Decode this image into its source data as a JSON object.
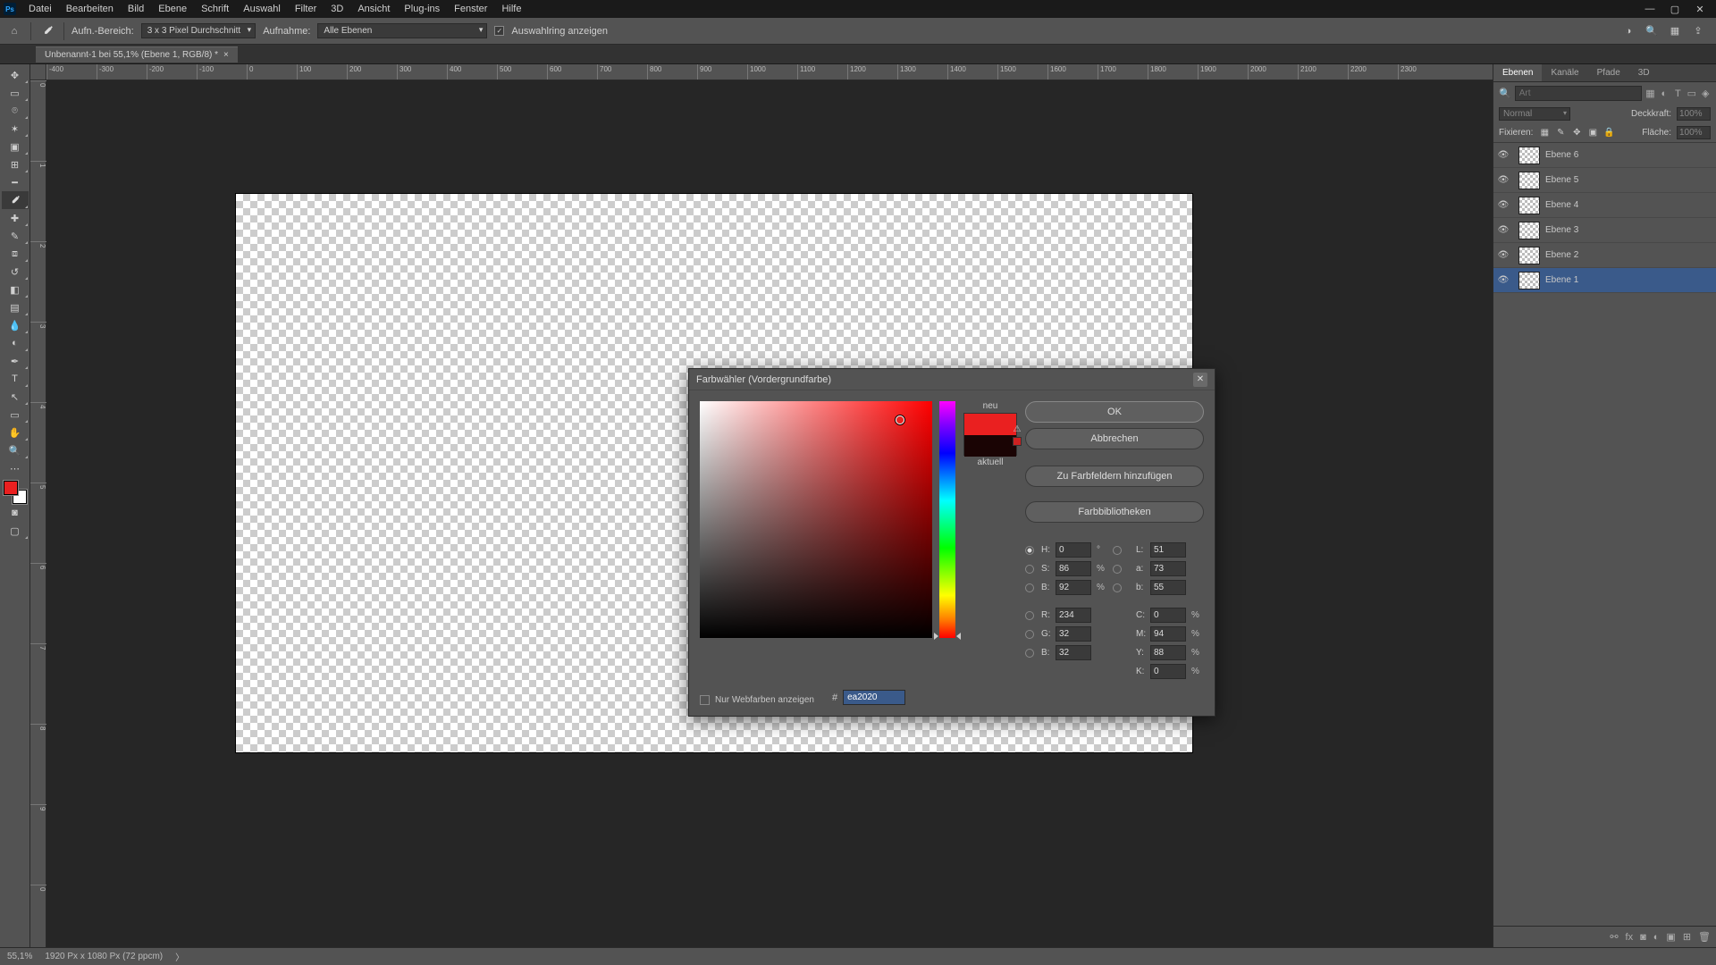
{
  "titlebar": {
    "logo": "Ps",
    "menu": [
      "Datei",
      "Bearbeiten",
      "Bild",
      "Ebene",
      "Schrift",
      "Auswahl",
      "Filter",
      "3D",
      "Ansicht",
      "Plug-ins",
      "Fenster",
      "Hilfe"
    ]
  },
  "options": {
    "label_sample": "Aufn.-Bereich:",
    "sample_value": "3 x 3 Pixel Durchschnitt",
    "label_layers": "Aufnahme:",
    "layers_value": "Alle Ebenen",
    "show_ring": "Auswahlring anzeigen"
  },
  "doc_tab": {
    "title": "Unbenannt-1 bei 55,1% (Ebene 1, RGB/8) *"
  },
  "ruler_h": [
    "-400",
    "-300",
    "-200",
    "-100",
    "0",
    "100",
    "200",
    "300",
    "400",
    "500",
    "600",
    "700",
    "800",
    "900",
    "1000",
    "1100",
    "1200",
    "1300",
    "1400",
    "1500",
    "1600",
    "1700",
    "1800",
    "1900",
    "2000",
    "2100",
    "2200",
    "2300"
  ],
  "ruler_v": [
    "0",
    "1",
    "2",
    "3",
    "4",
    "5",
    "6",
    "7",
    "8",
    "9",
    "0"
  ],
  "panel": {
    "tabs": [
      "Ebenen",
      "Kanäle",
      "Pfade",
      "3D"
    ],
    "search_placeholder": "Art",
    "blend_mode": "Normal",
    "opacity_label": "Deckkraft:",
    "opacity_value": "100%",
    "lock_label": "Fixieren:",
    "fill_label": "Fläche:",
    "fill_value": "100%",
    "layers": [
      "Ebene 6",
      "Ebene 5",
      "Ebene 4",
      "Ebene 3",
      "Ebene 2",
      "Ebene 1"
    ]
  },
  "status": {
    "zoom": "55,1%",
    "info": "1920 Px x 1080 Px (72 ppcm)"
  },
  "dialog": {
    "title": "Farbwähler (Vordergrundfarbe)",
    "new": "neu",
    "current": "aktuell",
    "ok": "OK",
    "cancel": "Abbrechen",
    "add": "Zu Farbfeldern hinzufügen",
    "libs": "Farbbibliotheken",
    "web_only": "Nur Webfarben anzeigen",
    "H": "H:",
    "S": "S:",
    "Bv": "B:",
    "L": "L:",
    "a": "a:",
    "b": "b:",
    "R": "R:",
    "G": "G:",
    "Bc": "B:",
    "C": "C:",
    "M": "M:",
    "Y": "Y:",
    "K": "K:",
    "vals": {
      "H": "0",
      "S": "86",
      "B": "92",
      "L": "51",
      "a": "73",
      "b": "55",
      "R": "234",
      "G": "32",
      "Bc": "32",
      "C": "0",
      "M": "94",
      "Y": "88",
      "K": "0"
    },
    "deg": "°",
    "pct": "%",
    "hash": "#",
    "hex": "ea2020"
  }
}
